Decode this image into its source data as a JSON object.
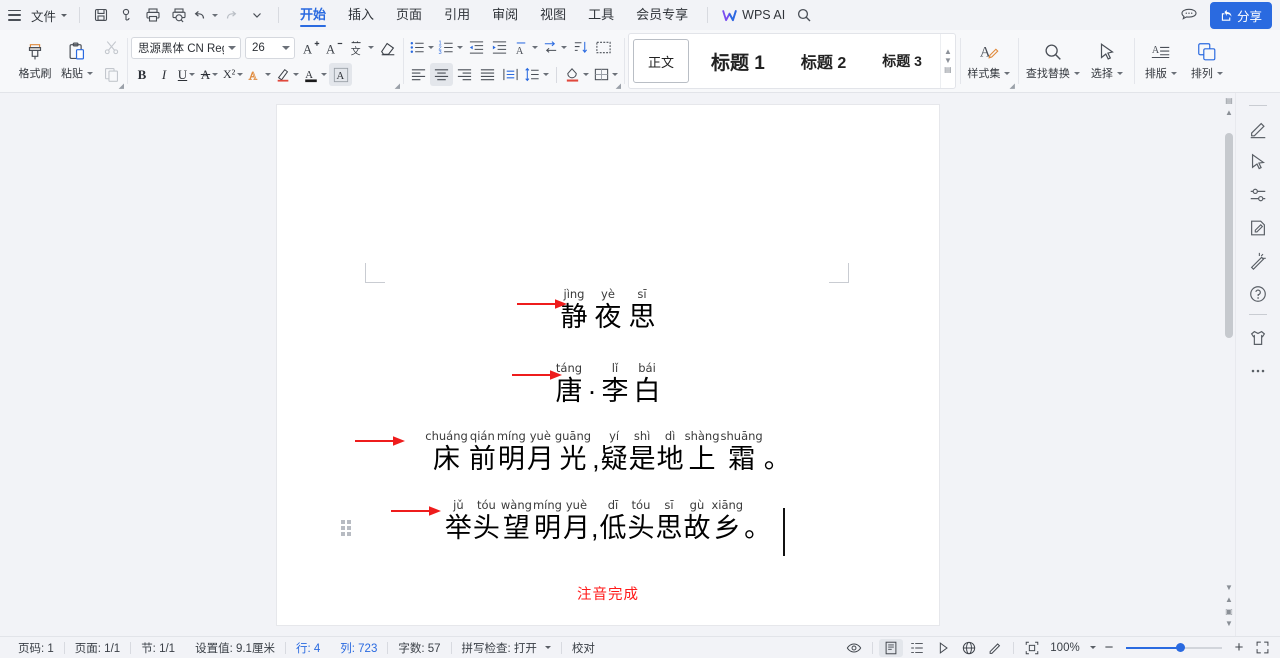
{
  "titlebar": {
    "menu_icon": "hamburger-icon",
    "file_label": "文件",
    "quick_access": [
      {
        "name": "save-icon",
        "label": "保存"
      },
      {
        "name": "cloud-sync-icon",
        "label": "同步"
      },
      {
        "name": "print-icon",
        "label": "打印"
      },
      {
        "name": "print-preview-icon",
        "label": "打印预览"
      },
      {
        "name": "undo-icon",
        "label": "撤销"
      },
      {
        "name": "redo-icon",
        "label": "恢复"
      },
      {
        "name": "customize-chevron-icon",
        "label": "自定义"
      }
    ],
    "tabs": [
      {
        "label": "开始",
        "active": true
      },
      {
        "label": "插入",
        "active": false
      },
      {
        "label": "页面",
        "active": false
      },
      {
        "label": "引用",
        "active": false
      },
      {
        "label": "审阅",
        "active": false
      },
      {
        "label": "视图",
        "active": false
      },
      {
        "label": "工具",
        "active": false
      },
      {
        "label": "会员专享",
        "active": false
      }
    ],
    "wps_ai_label": "WPS AI",
    "search_icon": "search-icon",
    "comment_icon": "comment-icon",
    "share_label": "分享",
    "accent_color": "#2a6ae0"
  },
  "ribbon": {
    "clipboard": {
      "format_painter_label": "格式刷",
      "paste_label": "粘贴",
      "cut_label": "剪切",
      "copy_label": "复制"
    },
    "font": {
      "family_value": "思源黑体 CN Regu",
      "size_value": "26",
      "grow_font": "A⁺",
      "shrink_font": "A⁻",
      "pinyin_guide_label": "拼音指南",
      "clear_format_label": "清除格式",
      "bold": "B",
      "italic": "I",
      "underline": "U",
      "strikethrough": "A",
      "superscript": "X²",
      "text_effect": "A",
      "highlight": "A",
      "font_color": "A",
      "char_shading": "A"
    },
    "paragraph": {
      "bullets": "项目符号",
      "numbering": "编号",
      "decrease_indent": "减少缩进",
      "increase_indent": "增加缩进",
      "pinyin": "拼音",
      "text_direction": "文字方向",
      "sort": "排序",
      "show_marks": "显示标记",
      "align_left": "左对齐",
      "align_center": "居中对齐",
      "align_right": "右对齐",
      "align_justify": "两端对齐",
      "distributed": "分散对齐",
      "line_spacing": "行距",
      "shading": "底纹",
      "borders": "边框"
    },
    "styles": [
      {
        "label": "正文",
        "selected": true
      },
      {
        "label": "标题 1",
        "selected": false
      },
      {
        "label": "标题 2",
        "selected": false
      },
      {
        "label": "标题 3",
        "selected": false
      }
    ],
    "tools": [
      {
        "label": "样式集",
        "icon": "style-set-icon",
        "caret": true
      },
      {
        "label": "查找替换",
        "icon": "search-icon",
        "caret": true
      },
      {
        "label": "选择",
        "icon": "cursor-select-icon",
        "caret": true
      },
      {
        "label": "排版",
        "icon": "typeset-icon",
        "caret": true
      },
      {
        "label": "排列",
        "icon": "arrange-icon",
        "caret": true
      }
    ]
  },
  "document": {
    "lines": [
      {
        "id": "title",
        "chars": [
          {
            "han": "静",
            "py": "jìng"
          },
          {
            "han": "夜",
            "py": "yè"
          },
          {
            "han": "思",
            "py": "sī"
          }
        ],
        "arrow": true
      },
      {
        "id": "author",
        "chars": [
          {
            "han": "唐",
            "py": "táng"
          },
          {
            "han": "·",
            "py": ""
          },
          {
            "han": "李",
            "py": "lǐ"
          },
          {
            "han": "白",
            "py": "bái"
          }
        ],
        "arrow": true
      },
      {
        "id": "verse1",
        "chars": [
          {
            "han": "床",
            "py": "chuáng"
          },
          {
            "han": "前",
            "py": "qián"
          },
          {
            "han": "明",
            "py": "míng"
          },
          {
            "han": "月",
            "py": "yuè"
          },
          {
            "han": "光",
            "py": "guāng"
          },
          {
            "han": ",",
            "py": ""
          },
          {
            "han": "疑",
            "py": "yí"
          },
          {
            "han": "是",
            "py": "shì"
          },
          {
            "han": "地",
            "py": "dì"
          },
          {
            "han": "上",
            "py": "shàng"
          },
          {
            "han": "霜",
            "py": "shuāng"
          },
          {
            "han": "。",
            "py": ""
          }
        ],
        "arrow": true
      },
      {
        "id": "verse2",
        "chars": [
          {
            "han": "举",
            "py": "jǔ"
          },
          {
            "han": "头",
            "py": "tóu"
          },
          {
            "han": "望",
            "py": "wàng"
          },
          {
            "han": "明",
            "py": "míng"
          },
          {
            "han": "月",
            "py": "yuè"
          },
          {
            "han": ",",
            "py": ""
          },
          {
            "han": "低",
            "py": "dī"
          },
          {
            "han": "头",
            "py": "tóu"
          },
          {
            "han": "思",
            "py": "sī"
          },
          {
            "han": "故",
            "py": "gù"
          },
          {
            "han": "乡",
            "py": "xiāng"
          },
          {
            "han": "。",
            "py": ""
          }
        ],
        "arrow": true
      }
    ],
    "done_text": "注音完成",
    "done_color": "#ff1a1a",
    "arrow_color": "#ee1c1c",
    "has_text_cursor": true,
    "paragraph_handle": true
  },
  "rail": [
    {
      "name": "minimize-panel-icon",
      "label": "收起"
    },
    {
      "name": "pen-edit-icon",
      "label": "编辑"
    },
    {
      "name": "cursor-icon",
      "label": "选择"
    },
    {
      "name": "settings-sliders-icon",
      "label": "设置"
    },
    {
      "name": "document-pen-icon",
      "label": "文档校对"
    },
    {
      "name": "magic-wand-icon",
      "label": "智能美化"
    },
    {
      "name": "help-circle-icon",
      "label": "帮助"
    },
    {
      "name": "skin-icon",
      "label": "皮肤"
    },
    {
      "name": "more-dots-icon",
      "label": "更多"
    }
  ],
  "status": {
    "left": [
      {
        "label": "页码: 1",
        "accent": false
      },
      {
        "label": "页面: 1/1",
        "accent": false
      },
      {
        "label": "节: 1/1",
        "accent": false
      },
      {
        "label": "设置值: 9.1厘米",
        "accent": false
      },
      {
        "label": "行: 4",
        "accent": true
      },
      {
        "label": "列: 723",
        "accent": true
      },
      {
        "label": "字数: 57",
        "accent": false
      },
      {
        "label": "拼写检查: 打开",
        "accent": false,
        "caret": true
      },
      {
        "label": "校对",
        "accent": false
      }
    ],
    "right_icons": [
      {
        "name": "eye-icon",
        "active": false
      },
      {
        "name": "page-layout-view-icon",
        "active": true
      },
      {
        "name": "outline-view-icon",
        "active": false
      },
      {
        "name": "reading-view-icon",
        "active": false
      },
      {
        "name": "web-view-icon",
        "active": false
      },
      {
        "name": "pen-write-icon",
        "active": false
      },
      {
        "name": "fullscreen-focus-icon",
        "active": false
      }
    ],
    "zoom_value": "100%",
    "zoom_minus": "−",
    "zoom_plus": "+",
    "fit_icon": "expand-icon"
  }
}
